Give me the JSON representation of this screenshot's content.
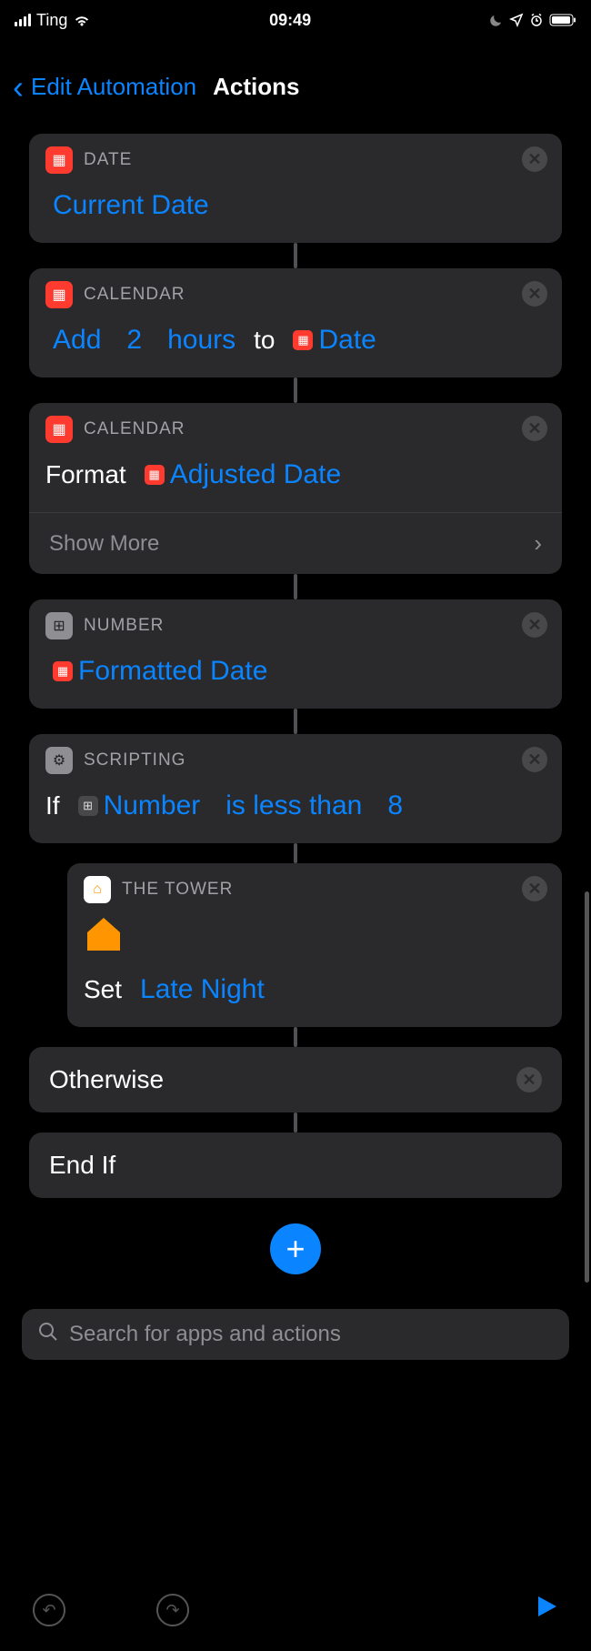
{
  "status": {
    "carrier": "Ting",
    "time": "09:49"
  },
  "nav": {
    "back": "Edit Automation",
    "title": "Actions"
  },
  "actions": {
    "date": {
      "category": "DATE",
      "value": "Current Date"
    },
    "add": {
      "category": "CALENDAR",
      "add_label": "Add",
      "amount": "2",
      "unit": "hours",
      "to": "to",
      "var": "Date"
    },
    "format": {
      "category": "CALENDAR",
      "format_label": "Format",
      "var": "Adjusted Date",
      "show_more": "Show More"
    },
    "number": {
      "category": "NUMBER",
      "var": "Formatted Date"
    },
    "ifblock": {
      "category": "SCRIPTING",
      "if_label": "If",
      "var": "Number",
      "condition": "is less than",
      "value": "8"
    },
    "home": {
      "category": "THE TOWER",
      "set_label": "Set",
      "scene": "Late Night"
    },
    "otherwise": "Otherwise",
    "endif": "End If"
  },
  "search": {
    "placeholder": "Search for apps and actions"
  }
}
